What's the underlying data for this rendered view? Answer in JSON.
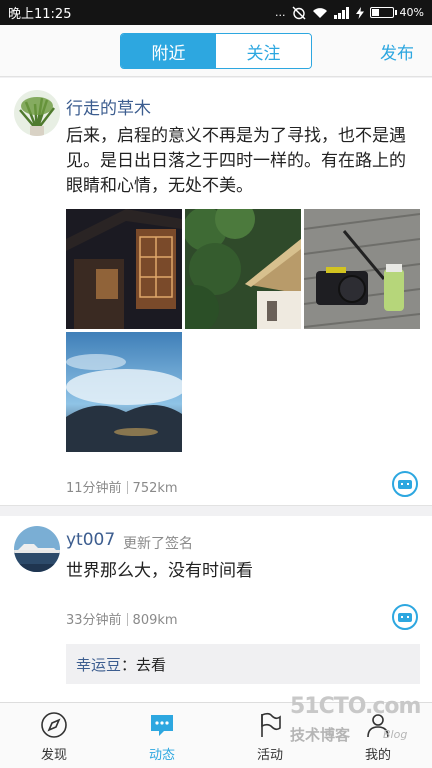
{
  "status": {
    "time": "晚上11:25",
    "dots": "...",
    "battery": "40%",
    "battery_level": 0.4
  },
  "header": {
    "tabs": [
      "附近",
      "关注"
    ],
    "active_tab": 0,
    "publish": "发布"
  },
  "posts": [
    {
      "author": "行走的草木",
      "text": "后来，启程的意义不再是为了寻找，也不是遇见。是日出日落之于四时一样的。有在路上的眼睛和心情，无处不美。",
      "time": "11分钟前",
      "distance": "752km",
      "photos": [
        "photo-traditional-building-window",
        "photo-thatched-hut-forest",
        "photo-camera-and-bottle",
        "photo-cloudy-sky"
      ]
    },
    {
      "author": "yt007",
      "status": "更新了签名",
      "text": "世界那么大，没有时间看",
      "time": "33分钟前",
      "distance": "809km",
      "comment": {
        "who": "幸运豆",
        "sep": "：",
        "text": "去看"
      }
    }
  ],
  "nav": [
    {
      "label": "发现",
      "icon": "compass-icon"
    },
    {
      "label": "动态",
      "icon": "chat-bubble-icon"
    },
    {
      "label": "活动",
      "icon": "flag-icon"
    },
    {
      "label": "我的",
      "icon": "person-icon"
    }
  ],
  "nav_active": 1,
  "watermark": {
    "line1": "51CTO.com",
    "line2": "技术博客",
    "line3": "Blog"
  },
  "colors": {
    "accent": "#2da7e0",
    "name": "#3c5d8f",
    "meta": "#8a8a8a"
  }
}
